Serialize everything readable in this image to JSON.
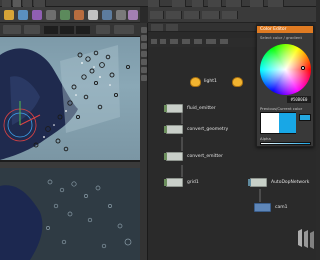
{
  "nodes": {
    "light": "light1",
    "fluid_emitter": "fluid_emitter",
    "convert_geometry": "convert_geometry",
    "convert_emitter": "convert_emitter",
    "grid": "grid1",
    "autodopnetwork": "AutoDopNetwork",
    "cam": "cam1"
  },
  "color_editor": {
    "title": "Color Editor",
    "subtitle": "Select color / gradient",
    "hex_value": "#50B0E0",
    "previous_label": "Previous/Current color",
    "alpha_label": "Alpha"
  },
  "colors": {
    "accent": "#e07b22",
    "light_node": "#f2b430",
    "selected_color": "#18a7e6"
  }
}
